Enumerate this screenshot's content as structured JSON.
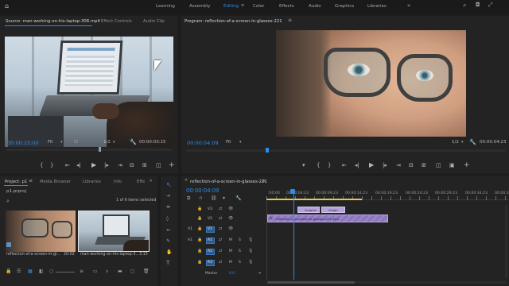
{
  "workspaces": [
    "Learning",
    "Assembly",
    "Editing",
    "Color",
    "Effects",
    "Audio",
    "Graphics",
    "Libraries"
  ],
  "active_workspace": "Editing",
  "source_panel": {
    "tabs": [
      "Source: man-working-on-his-laptop-308.mp4",
      "Effect Controls",
      "Audio Clip"
    ],
    "timecode": "00:00:15:00",
    "fit": "Fit",
    "resolution": "1/2",
    "duration": "00:00:03:15"
  },
  "program_panel": {
    "title": "Program: reflection-of-a-screen-in-glasses-221",
    "timecode": "00:00:04:09",
    "fit": "Fit",
    "resolution": "1/2",
    "duration": "00:00:04:23"
  },
  "project_panel": {
    "tabs": [
      "Project: p1",
      "Media Browser",
      "Libraries",
      "Info",
      "Effe"
    ],
    "file": "p1.prproj",
    "selection": "1 of 6 items selected",
    "items": [
      {
        "name": "reflection-of-a-screen-in-gl...",
        "duration": "20:02"
      },
      {
        "name": "man-working-on-his-laptop-3...",
        "duration": "3:15"
      }
    ]
  },
  "timeline": {
    "title": "reflection-of-a-screen-in-glasses-221",
    "timecode": "00:00:04:09",
    "ticks": [
      ":00:00",
      "00:00:04:23",
      "00:00:09:23",
      "00:00:14:23",
      "00:00:19:23",
      "00:00:24:23",
      "00:00:29:23",
      "00:00:34:23",
      "00:00:3"
    ],
    "tracks": [
      {
        "name": "V3"
      },
      {
        "name": "V2"
      },
      {
        "name": "V1"
      },
      {
        "name": "A1",
        "m": "M",
        "s": "S"
      },
      {
        "name": "A2",
        "m": "M",
        "s": "S"
      },
      {
        "name": "A3",
        "m": "M",
        "s": "S"
      }
    ],
    "master": "Master",
    "master_value": "0.0",
    "clip_label": "reflection-of-a-screen-in-glasses-221.mp4",
    "title_clips": [
      "Graphic",
      "Graph"
    ]
  },
  "colors": {
    "accent": "#2d8ceb",
    "clip_video": "#9a83c9",
    "clip_title": "#b4a3d8"
  }
}
